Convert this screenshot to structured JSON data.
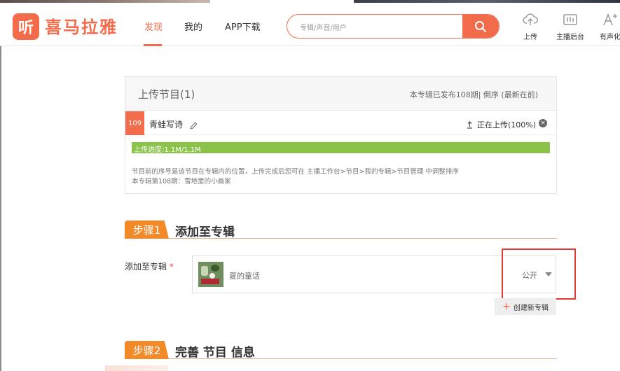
{
  "header": {
    "logo_glyph": "听",
    "logo_text": "喜马拉雅",
    "nav": [
      {
        "label": "发现",
        "active": true
      },
      {
        "label": "我的",
        "active": false
      },
      {
        "label": "APP下载",
        "active": false
      }
    ],
    "search_placeholder": "专辑/声音/用户",
    "tools": [
      {
        "label": "上传",
        "icon": "upload-cloud-icon"
      },
      {
        "label": "主播后台",
        "icon": "dashboard-icon"
      },
      {
        "label": "有声化",
        "icon": "text-size-icon"
      }
    ]
  },
  "upload_panel": {
    "title": "上传节目(1)",
    "meta": "本专辑已发布108期| 倒序 (最新在前)",
    "track": {
      "number": "109",
      "name": "青蛙写诗",
      "status": "正在上传(100%)"
    },
    "progress": {
      "label": "上传进度:1.1M/1.1M",
      "fraction": 1.0
    },
    "note_lines": [
      "节目前的序号是该节目在专辑内的位置，上传完成后您可在 主播工作台>节目>我的专辑>节目管理 中调整排序",
      "本专辑第108期：雪地里的小画家"
    ]
  },
  "step1": {
    "badge": "步骤1",
    "heading": "添加至专辑"
  },
  "album_field": {
    "label": "添加至专辑",
    "required_mark": "*",
    "album_name": "夏的童话",
    "privacy": "公开",
    "create_label": "创建新专辑"
  },
  "step2": {
    "badge": "步骤2",
    "heading": "完善 节目 信息"
  },
  "colors": {
    "brand": "#f26b4a",
    "step_badge": "#f28a2a",
    "progress": "#8bc34a",
    "highlight": "#e53935"
  }
}
